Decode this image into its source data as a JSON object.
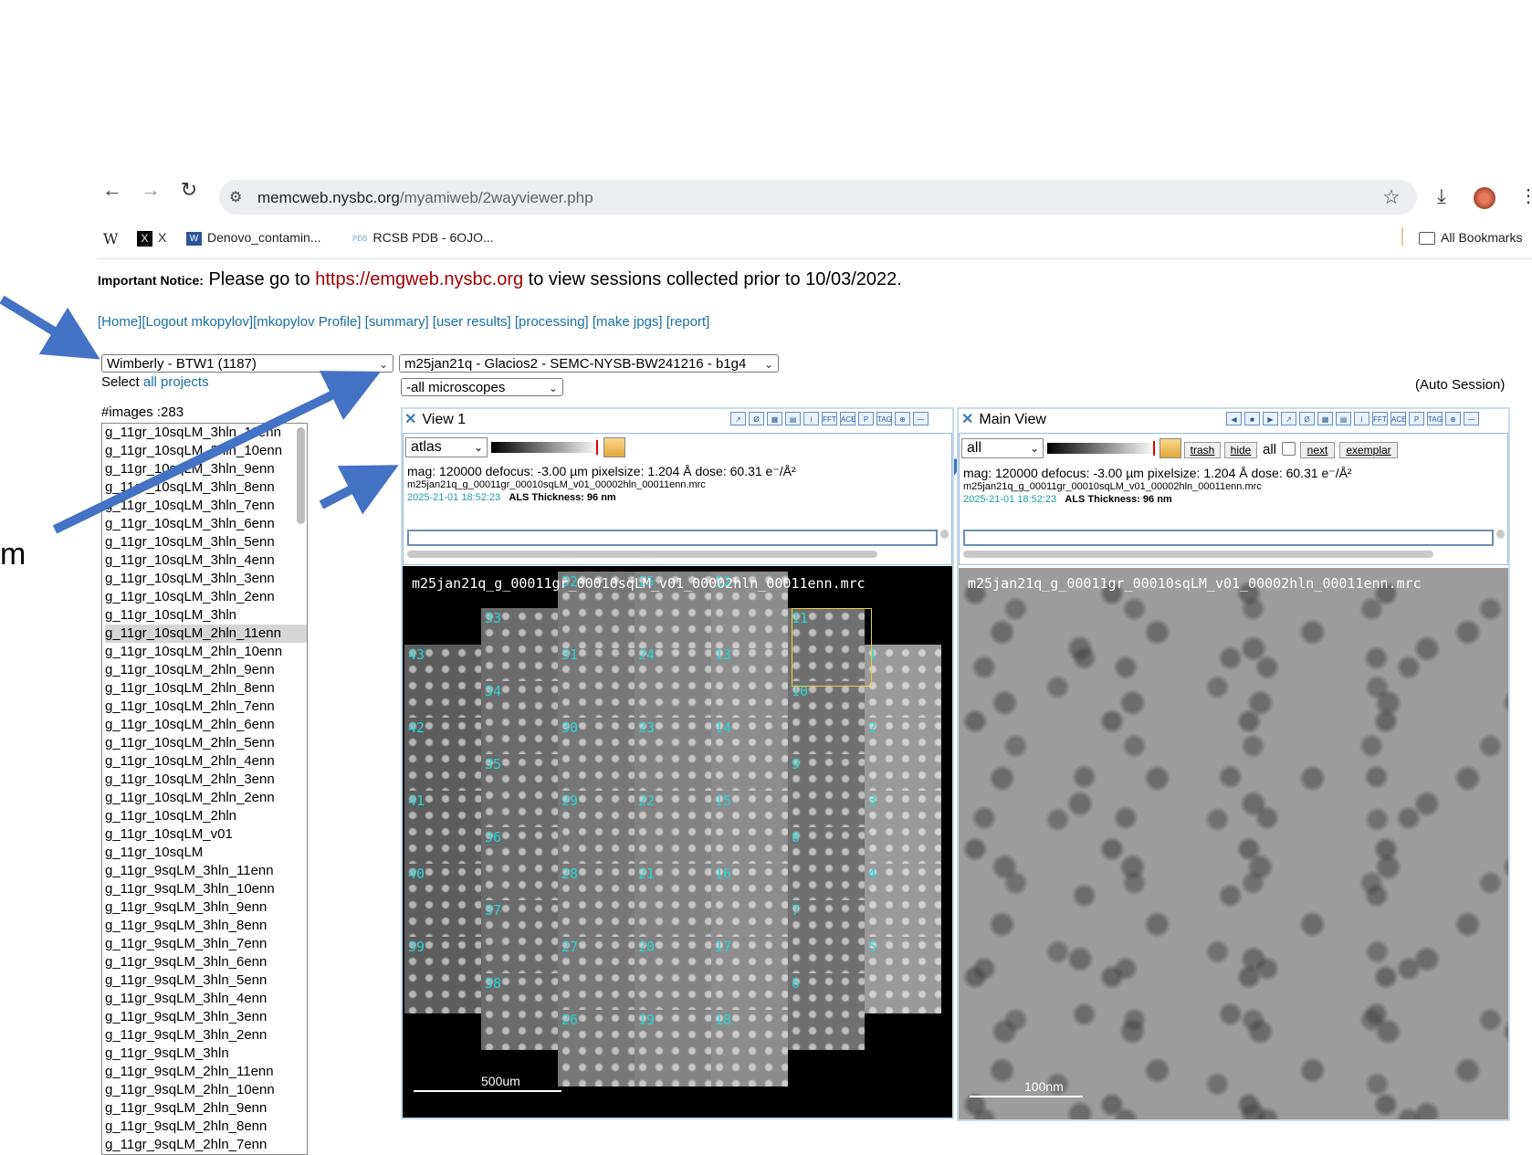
{
  "browser": {
    "url_host": "memcweb.nysbc.org",
    "url_path": "/myamiweb/2wayviewer.php",
    "bookmarks": [
      {
        "icon": "W",
        "label": ""
      },
      {
        "icon": "x-logo",
        "label": "X"
      },
      {
        "icon": "word-doc",
        "label": "Denovo_contamin..."
      },
      {
        "icon": "pdb",
        "label": "RCSB PDB - 6OJO..."
      }
    ],
    "all_bookmarks": "All Bookmarks"
  },
  "notice": {
    "prefix": "Important Notice:",
    "text1": "Please go to",
    "link": "https://emgweb.nysbc.org",
    "text2": "to view sessions collected prior to 10/03/2022."
  },
  "nav_links": "[Home][Logout mkopylov][mkopylov Profile] [summary] [user results] [processing] [make jpgs] [report]",
  "project_select": "Wimberly - BTW1 (1187)",
  "select_label": "Select",
  "all_projects_link": "all projects",
  "session_select": "m25jan21q - Glacios2 - SEMC-NYSB-BW241216 - b1g4",
  "microscope_select": "-all microscopes",
  "auto_session": "(Auto Session)",
  "image_count": "#images :283",
  "image_list": [
    "g_11gr_10sqLM_3hln_11enn",
    "g_11gr_10sqLM_3hln_10enn",
    "g_11gr_10sqLM_3hln_9enn",
    "g_11gr_10sqLM_3hln_8enn",
    "g_11gr_10sqLM_3hln_7enn",
    "g_11gr_10sqLM_3hln_6enn",
    "g_11gr_10sqLM_3hln_5enn",
    "g_11gr_10sqLM_3hln_4enn",
    "g_11gr_10sqLM_3hln_3enn",
    "g_11gr_10sqLM_3hln_2enn",
    "g_11gr_10sqLM_3hln",
    "g_11gr_10sqLM_2hln_11enn",
    "g_11gr_10sqLM_2hln_10enn",
    "g_11gr_10sqLM_2hln_9enn",
    "g_11gr_10sqLM_2hln_8enn",
    "g_11gr_10sqLM_2hln_7enn",
    "g_11gr_10sqLM_2hln_6enn",
    "g_11gr_10sqLM_2hln_5enn",
    "g_11gr_10sqLM_2hln_4enn",
    "g_11gr_10sqLM_2hln_3enn",
    "g_11gr_10sqLM_2hln_2enn",
    "g_11gr_10sqLM_2hln",
    "g_11gr_10sqLM_v01",
    "g_11gr_10sqLM",
    "g_11gr_9sqLM_3hln_11enn",
    "g_11gr_9sqLM_3hln_10enn",
    "g_11gr_9sqLM_3hln_9enn",
    "g_11gr_9sqLM_3hln_8enn",
    "g_11gr_9sqLM_3hln_7enn",
    "g_11gr_9sqLM_3hln_6enn",
    "g_11gr_9sqLM_3hln_5enn",
    "g_11gr_9sqLM_3hln_4enn",
    "g_11gr_9sqLM_3hln_3enn",
    "g_11gr_9sqLM_3hln_2enn",
    "g_11gr_9sqLM_3hln",
    "g_11gr_9sqLM_2hln_11enn",
    "g_11gr_9sqLM_2hln_10enn",
    "g_11gr_9sqLM_2hln_9enn",
    "g_11gr_9sqLM_2hln_8enn",
    "g_11gr_9sqLM_2hln_7enn"
  ],
  "selected_index": 11,
  "view1": {
    "title": "View 1",
    "preset": "atlas",
    "mag_line": "mag: 120000 defocus: -3.00 µm pixelsize: 1.204 Å dose: 60.31 e⁻/Å²",
    "filename": "m25jan21q_g_00011gr_00010sqLM_v01_00002hln_00011enn.mrc",
    "timestamp": "2025-21-01 18:52:23",
    "thickness": "ALS Thickness: 96 nm",
    "image_title": "m25jan21q_g_00011gr_00010sqLM_v01_00002hln_00011enn.mrc",
    "scale": "500um",
    "tile_numbers": [
      "33",
      "43",
      "31",
      "24",
      "13",
      "11",
      "1",
      "34",
      "10",
      "42",
      "30",
      "23",
      "14",
      "2",
      "35",
      "9",
      "41",
      "29",
      "22",
      "15",
      "3",
      "36",
      "8",
      "40",
      "28",
      "21",
      "16",
      "4",
      "37",
      "7",
      "39",
      "27",
      "20",
      "17",
      "5",
      "38",
      "6",
      "26",
      "19",
      "18",
      "32",
      "25",
      "12"
    ]
  },
  "main_view": {
    "title": "Main View",
    "preset": "all",
    "btn_trash": "trash",
    "btn_hide": "hide",
    "all_label": "all",
    "btn_next": "next",
    "btn_exemplar": "exemplar",
    "mag_line": "mag: 120000 defocus: -3.00 µm pixelsize: 1.204 Å dose: 60.31 e⁻/Å²",
    "filename": "m25jan21q_g_00011gr_00010sqLM_v01_00002hln_00011enn.mrc",
    "timestamp": "2025-21-01 18:52:23",
    "thickness": "ALS Thickness: 96 nm",
    "image_title": "m25jan21q_g_00011gr_00010sqLM_v01_00002hln_00011enn.mrc",
    "scale": "100nm"
  },
  "side_text": "m",
  "colors": {
    "arrow": "#4472c4",
    "link": "#1a6fa0",
    "notice_link": "#a00000",
    "tile_label": "#2bd3d3"
  }
}
